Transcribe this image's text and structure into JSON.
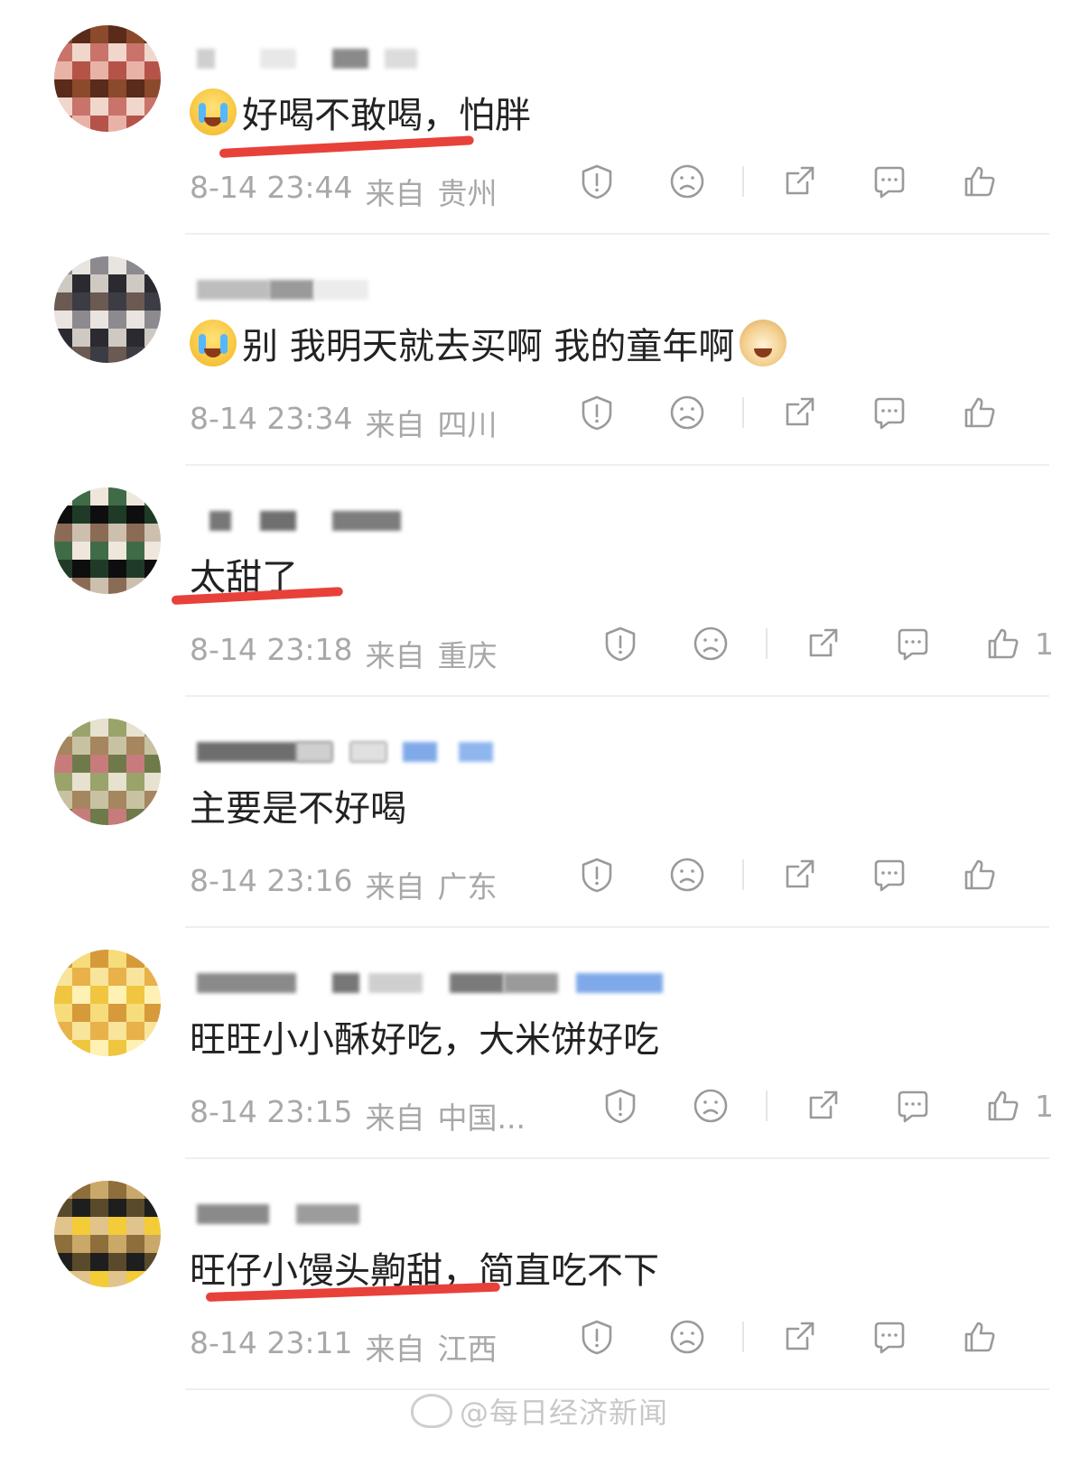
{
  "comments": [
    {
      "text": "好喝不敢喝，怕胖",
      "emoji_before": "crying-laughing-emoji",
      "emoji_after": "",
      "underline": true,
      "time": "8-14 23:44",
      "from_label": "来自",
      "location": "贵州",
      "likes": ""
    },
    {
      "text": "别 我明天就去买啊 我的童年啊",
      "emoji_before": "crying-emoji",
      "emoji_after": "doge-emoji",
      "underline": false,
      "time": "8-14 23:34",
      "from_label": "来自",
      "location": "四川",
      "likes": ""
    },
    {
      "text": "太甜了",
      "emoji_before": "",
      "emoji_after": "",
      "underline": true,
      "time": "8-14 23:18",
      "from_label": "来自",
      "location": "重庆",
      "likes": "1"
    },
    {
      "text": "主要是不好喝",
      "emoji_before": "",
      "emoji_after": "",
      "underline": false,
      "time": "8-14 23:16",
      "from_label": "来自",
      "location": "广东",
      "likes": ""
    },
    {
      "text": "旺旺小小酥好吃，大米饼好吃",
      "emoji_before": "",
      "emoji_after": "",
      "underline": false,
      "time": "8-14 23:15",
      "from_label": "来自",
      "location": "中国...",
      "likes": "1"
    },
    {
      "text": "旺仔小馒头齁甜，简直吃不下",
      "emoji_before": "",
      "emoji_after": "",
      "underline": true,
      "time": "8-14 23:11",
      "from_label": "来自",
      "location": "江西",
      "likes": ""
    }
  ],
  "action_icons": [
    "report-icon",
    "dislike-icon",
    "share-icon",
    "reply-icon",
    "like-icon"
  ],
  "watermark": "@每日经济新闻",
  "colors": {
    "text": "#222222",
    "meta": "#a8a8a8",
    "underline": "#e8413a",
    "divider": "#efefef",
    "icon": "#9a9a9a"
  }
}
